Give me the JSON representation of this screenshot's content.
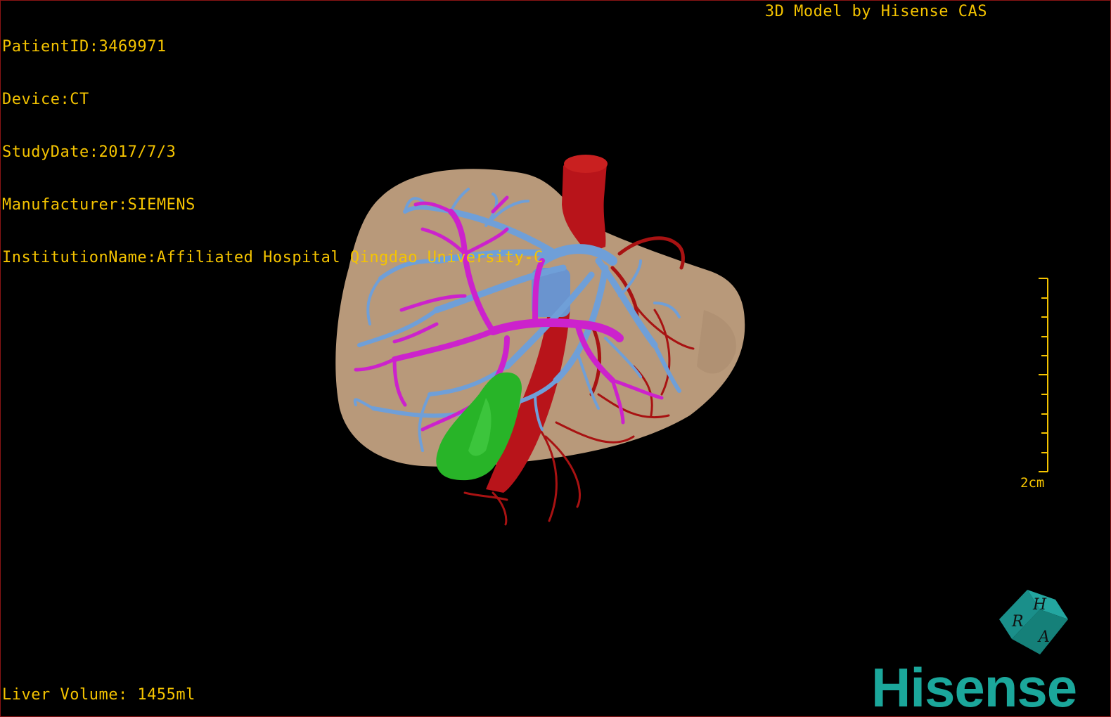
{
  "overlay": {
    "patient_id": "PatientID:3469971",
    "device": "Device:CT",
    "study_date": "StudyDate:2017/7/3",
    "manufacturer": "Manufacturer:SIEMENS",
    "institution": "InstitutionName:Affiliated Hospital Qingdao University-C",
    "model_by": "3D Model by Hisense CAS",
    "liver_volume": "Liver Volume: 1455ml"
  },
  "scale_bar": {
    "label": "2cm"
  },
  "orientation_cube": {
    "faces": [
      "H",
      "R",
      "A"
    ],
    "color": "#1a8f8a"
  },
  "logo": {
    "text": "Hisense",
    "color": "#1ba79b"
  },
  "colors": {
    "liver": "#b8997a",
    "artery": "#c01515",
    "portal_vein": "#cc22cc",
    "hepatic_vein": "#6f9fd8",
    "gallbladder": "#28b428",
    "text": "#f5c400"
  },
  "icons": [
    "orientation-cube-icon"
  ]
}
